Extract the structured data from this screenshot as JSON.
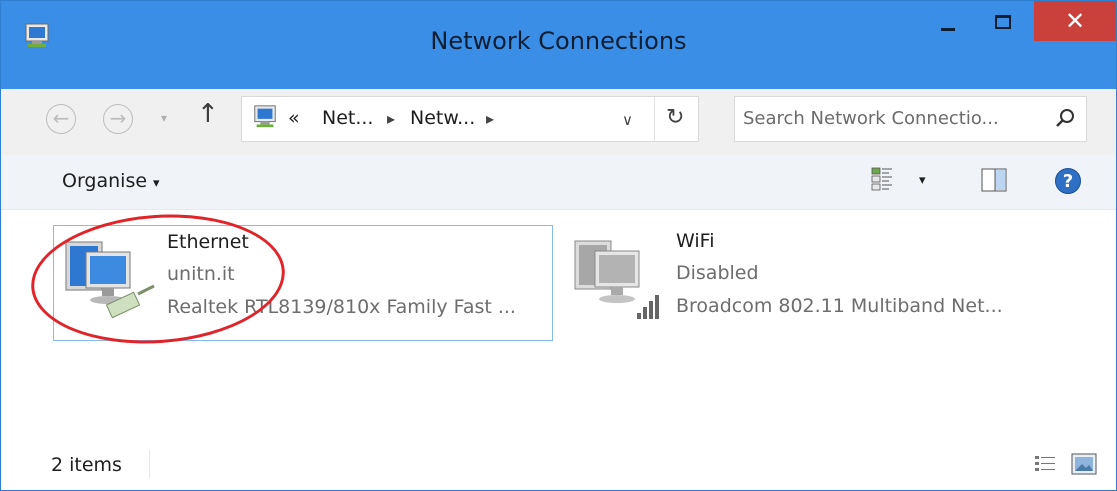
{
  "window": {
    "title": "Network Connections",
    "close_glyph": "✕",
    "colors": {
      "titlebar": "#3a8ee6",
      "close": "#c9413a",
      "accent": "#2f7fd0"
    }
  },
  "nav": {
    "back_glyph": "←",
    "forward_glyph": "→",
    "recent_glyph": "▾",
    "up_glyph": "↑"
  },
  "address": {
    "overflow": "«",
    "crumbs": [
      "Net...",
      "Netw..."
    ],
    "chevron": "▸",
    "dropdown_glyph": "∨",
    "refresh_glyph": "↻"
  },
  "search": {
    "placeholder": "Search Network Connectio..."
  },
  "toolbar": {
    "organise_label": "Organise",
    "caret": "▾"
  },
  "items": [
    {
      "name": "Ethernet",
      "status": "unitn.it",
      "device": "Realtek RTL8139/810x Family Fast ...",
      "icon": "ethernet-adapter-icon",
      "selected": true
    },
    {
      "name": "WiFi",
      "status": "Disabled",
      "device": "Broadcom 802.11 Multiband Net...",
      "icon": "wifi-adapter-icon",
      "selected": false
    }
  ],
  "statusbar": {
    "count": "2 items"
  },
  "annotation": {
    "color": "#e0242a"
  }
}
